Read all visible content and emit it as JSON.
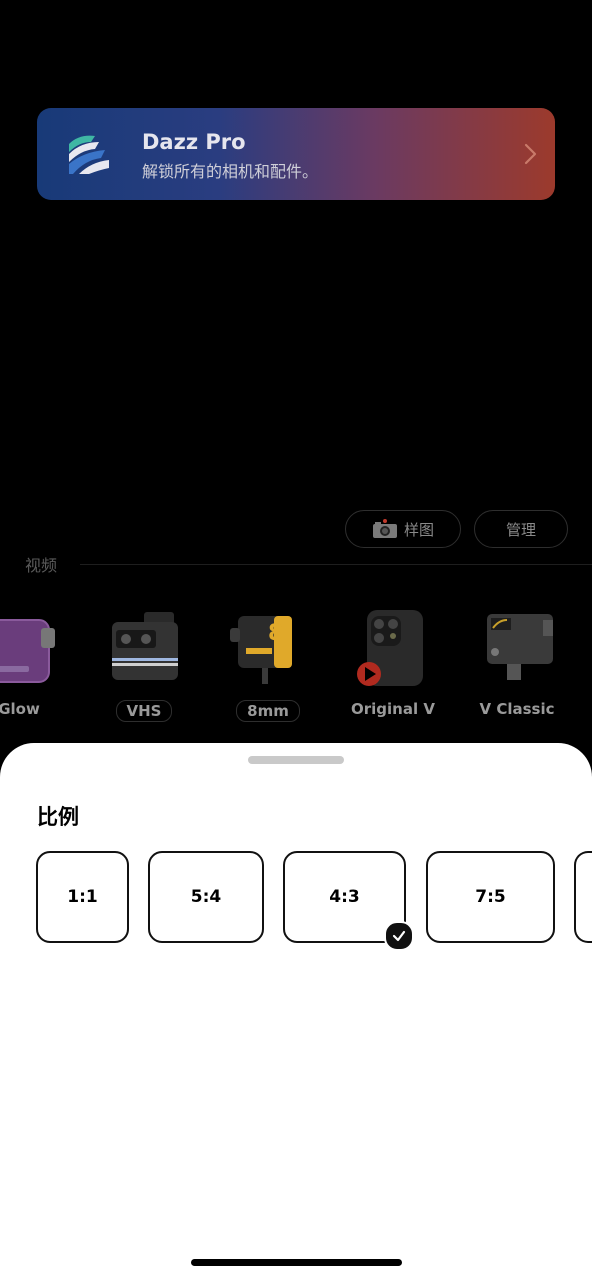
{
  "promo": {
    "title": "Dazz Pro",
    "subtitle": "解锁所有的相机和配件。"
  },
  "toolbar": {
    "sample_label": "样图",
    "manage_label": "管理"
  },
  "section": {
    "label": "视频"
  },
  "cameras": [
    {
      "label": "Glow",
      "icon": "glow-camera-icon",
      "boxed": false
    },
    {
      "label": "VHS",
      "icon": "vhs-camera-icon",
      "boxed": true
    },
    {
      "label": "8mm",
      "icon": "8mm-camera-icon",
      "boxed": true
    },
    {
      "label": "Original V",
      "icon": "phone-video-camera-icon",
      "boxed": false
    },
    {
      "label": "V Classic",
      "icon": "v-classic-camera-icon",
      "boxed": false
    }
  ],
  "sheet": {
    "title": "比例",
    "ratios": [
      {
        "label": "1:1",
        "selected": false
      },
      {
        "label": "5:4",
        "selected": false
      },
      {
        "label": "4:3",
        "selected": true
      },
      {
        "label": "7:5",
        "selected": false
      }
    ]
  },
  "colors": {
    "promo_gradient_start": "#183a78",
    "promo_gradient_end": "#9c3a2c",
    "sheet_background": "#ffffff",
    "selected_check": "#111111"
  }
}
